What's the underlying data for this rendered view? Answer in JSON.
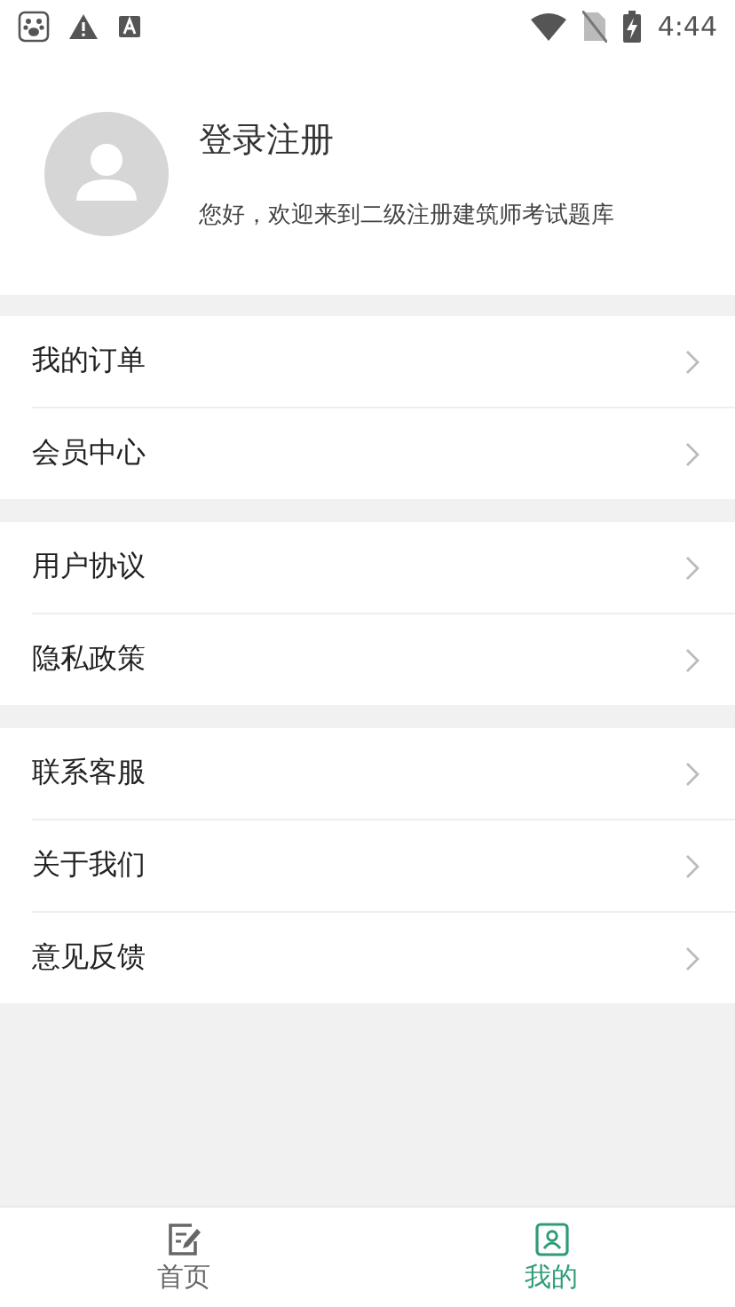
{
  "status_bar": {
    "time": "4:44"
  },
  "profile": {
    "title": "登录注册",
    "subtitle": "您好，欢迎来到二级注册建筑师考试题库"
  },
  "menu_groups": [
    {
      "items": [
        {
          "label": "我的订单"
        },
        {
          "label": "会员中心"
        }
      ]
    },
    {
      "items": [
        {
          "label": "用户协议"
        },
        {
          "label": "隐私政策"
        }
      ]
    },
    {
      "items": [
        {
          "label": "联系客服"
        },
        {
          "label": "关于我们"
        },
        {
          "label": "意见反馈"
        }
      ]
    }
  ],
  "tabs": [
    {
      "label": "首页",
      "selected": false
    },
    {
      "label": "我的",
      "selected": true
    }
  ]
}
